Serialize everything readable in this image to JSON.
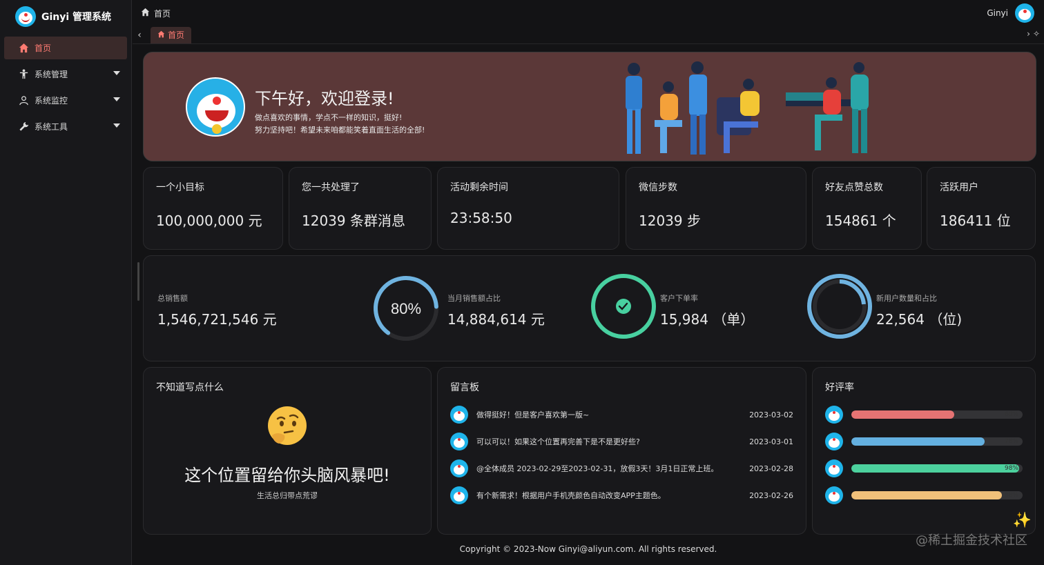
{
  "app": {
    "brand": "Ginyi 管理系统"
  },
  "sidebar": {
    "items": [
      {
        "label": "首页",
        "icon": "home-icon"
      },
      {
        "label": "系统管理",
        "icon": "person-icon"
      },
      {
        "label": "系统监控",
        "icon": "user-icon"
      },
      {
        "label": "系统工具",
        "icon": "wrench-icon"
      }
    ]
  },
  "header": {
    "breadcrumb": "首页",
    "username": "Ginyi"
  },
  "tabs": {
    "items": [
      {
        "label": "首页"
      }
    ]
  },
  "banner": {
    "title": "下午好，欢迎登录!",
    "line1": "做点喜欢的事情，学点不一样的知识，挺好!",
    "line2": "努力坚持吧！希望未来咱都能笑着直面生活的全部!"
  },
  "stats": [
    {
      "label": "一个小目标",
      "value": "100,000,000  元"
    },
    {
      "label": "您一共处理了",
      "value": "12039  条群消息"
    },
    {
      "label": "活动剩余时间",
      "value": "23:58:50"
    },
    {
      "label": "微信步数",
      "value": "12039  步"
    },
    {
      "label": "好友点赞总数",
      "value": "154861  个"
    },
    {
      "label": "活跃用户",
      "value": "186411  位"
    }
  ],
  "sales": {
    "total_label": "总销售额",
    "total_value": "1,546,721,546  元",
    "ring1_text": "80%",
    "ring1_percent": 80,
    "month_label": "当月销售额占比",
    "month_value": "14,884,614  元",
    "order_label": "客户下单率",
    "order_value": "15,984   （单）",
    "newuser_label": "新用户数量和占比",
    "newuser_value": "22,564   （位)",
    "colors": {
      "ring1": "#6fb3e0",
      "ring2": "#48d0a0",
      "ring3": "#6fb3e0"
    }
  },
  "brain": {
    "title": "不知道写点什么",
    "headline": "这个位置留给你头脑风暴吧!",
    "sub": "生活总归带点荒谬"
  },
  "messages": {
    "title": "留言板",
    "items": [
      {
        "text": "做得挺好！但是客户喜欢第一版~",
        "date": "2023-03-02"
      },
      {
        "text": "可以可以！如果这个位置再完善下是不是更好些?",
        "date": "2023-03-01"
      },
      {
        "text": "@全体成员 2023-02-29至2023-02-31，放假3天！3月1日正常上班。",
        "date": "2023-02-28"
      },
      {
        "text": "有个新需求！根据用户手机壳颜色自动改变APP主题色。",
        "date": "2023-02-26"
      }
    ]
  },
  "rating": {
    "title": "好评率",
    "bars": [
      {
        "label": "60%",
        "percent": 60,
        "color": "#e57373"
      },
      {
        "label": "78%",
        "percent": 78,
        "color": "#64b0e0"
      },
      {
        "label": "98%",
        "percent": 98,
        "color": "#4cd19e"
      },
      {
        "label": "88%",
        "percent": 88,
        "color": "#f0c07a"
      }
    ]
  },
  "footer": {
    "text": "Copyright © 2023-Now Ginyi@aliyun.com. All rights reserved."
  },
  "watermark": "@稀土掘金技术社区"
}
